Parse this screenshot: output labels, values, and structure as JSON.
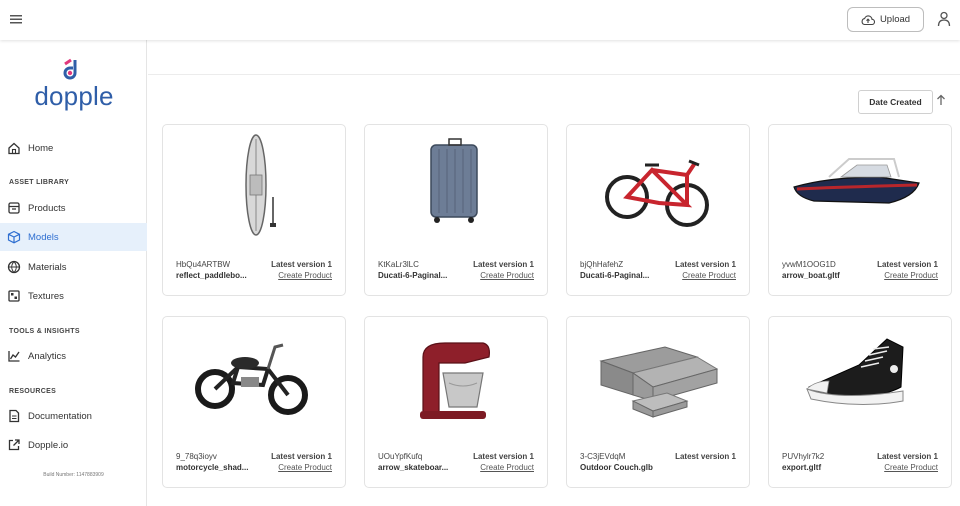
{
  "topbar": {
    "menu_icon": "hamburger-icon",
    "upload_label": "Upload",
    "upload_icon": "cloud-upload-icon",
    "user_icon": "user-icon"
  },
  "brand": {
    "name": "dopple",
    "color": "#2f5ea8",
    "accent": "#e0387d"
  },
  "sidebar": {
    "home": "Home",
    "section_asset": "ASSET LIBRARY",
    "products": "Products",
    "models": "Models",
    "materials": "Materials",
    "textures": "Textures",
    "section_tools": "TOOLS & INSIGHTS",
    "analytics": "Analytics",
    "section_resources": "RESOURCES",
    "documentation": "Documentation",
    "dopple_io": "Dopple.io",
    "build": "Build Number: 1147883909",
    "active_item": "Models",
    "active_color": "#2f6fd1"
  },
  "sort": {
    "label": "Date Created",
    "direction_icon": "arrow-up-icon"
  },
  "cards": [
    {
      "id": "HbQu4ARTBW",
      "file": "reflect_paddlebo...",
      "version": "Latest version 1",
      "action": "Create Product"
    },
    {
      "id": "KtKaLr3lLC",
      "file": "Ducati-6-Paginal...",
      "version": "Latest version 1",
      "action": "Create Product"
    },
    {
      "id": "bjQhHafehZ",
      "file": "Ducati-6-Paginal...",
      "version": "Latest version 1",
      "action": "Create Product"
    },
    {
      "id": "yvwM1OOG1D",
      "file": "arrow_boat.gltf",
      "version": "Latest version 1",
      "action": "Create Product"
    },
    {
      "id": "9_78q3ioyv",
      "file": "motorcycle_shad...",
      "version": "Latest version 1",
      "action": "Create Product"
    },
    {
      "id": "UOuYpfKufq",
      "file": "arrow_skateboar...",
      "version": "Latest version 1",
      "action": "Create Product"
    },
    {
      "id": "3-C3jEVdqM",
      "file": "Outdoor Couch.glb",
      "version": "Latest version 1",
      "action": ""
    },
    {
      "id": "PUVhylr7k2",
      "file": "export.gltf",
      "version": "Latest version 1",
      "action": "Create Product"
    }
  ]
}
